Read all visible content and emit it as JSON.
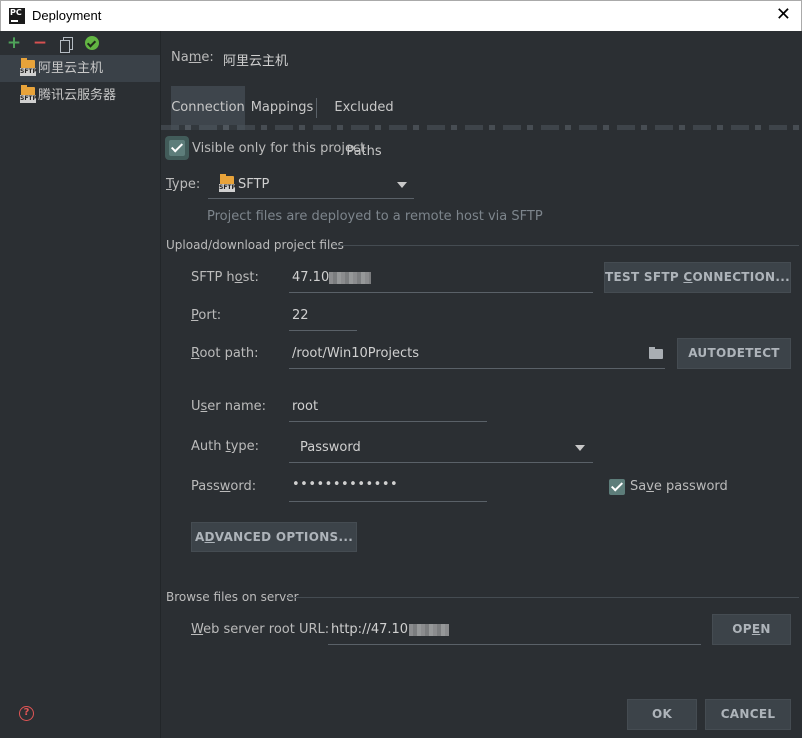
{
  "window": {
    "app_icon": "PC",
    "title": "Deployment",
    "close": "✕"
  },
  "sidebar": {
    "toolbar": {
      "add": "+",
      "remove": "−"
    },
    "servers": [
      {
        "label": "阿里云主机",
        "icon_tag": "SFTP"
      },
      {
        "label": "腾讯云服务器",
        "icon_tag": "SFTP"
      }
    ],
    "help": "?"
  },
  "name": {
    "label_pre": "Na",
    "label_mnemonic": "m",
    "label_post": "e:",
    "value": "阿里云主机"
  },
  "tabs": [
    {
      "label": "Connection",
      "active": true
    },
    {
      "label": "Mappings",
      "active": false
    },
    {
      "label": "Excluded Paths",
      "active": false
    }
  ],
  "visible_only": {
    "label": "Visible only for this project",
    "checked": true
  },
  "type": {
    "label_mnemonic": "T",
    "label_post": "ype:",
    "value": "SFTP",
    "icon_tag": "SFTP",
    "hint": "Project files are deployed to a remote host via SFTP"
  },
  "upload_section": {
    "title": "Upload/download project files",
    "sftp_host": {
      "label_pre": "SFTP h",
      "label_mnemonic": "o",
      "label_post": "st:",
      "value": "47.10"
    },
    "test_button": {
      "pre": "TEST SFTP ",
      "mnemonic": "C",
      "post": "ONNECTION..."
    },
    "port": {
      "label_mnemonic": "P",
      "label_post": "ort:",
      "value": "22"
    },
    "root_path": {
      "label_mnemonic": "R",
      "label_post": "oot path:",
      "value": "/root/Win10Projects"
    },
    "autodetect_button": "AUTODETECT",
    "user_name": {
      "label_pre": "U",
      "label_mnemonic": "s",
      "label_post": "er name:",
      "value": "root"
    },
    "auth_type": {
      "label_pre": "Auth ",
      "label_mnemonic": "t",
      "label_post": "ype:",
      "value": "Password"
    },
    "password": {
      "label_pre": "Pass",
      "label_mnemonic": "w",
      "label_post": "ord:",
      "value": "•••••••••••••"
    },
    "save_password": {
      "label_pre": "Sa",
      "label_mnemonic": "v",
      "label_post": "e password",
      "checked": true
    },
    "advanced_button": {
      "pre": "A",
      "mnemonic": "D",
      "post": "VANCED OPTIONS..."
    }
  },
  "browse_section": {
    "title": "Browse files on server",
    "web_root": {
      "label_mnemonic": "W",
      "label_post": "eb server root URL:",
      "value": "http://47.10"
    },
    "open_button": {
      "pre": "OP",
      "mnemonic": "E",
      "post": "N"
    }
  },
  "footer": {
    "ok": "OK",
    "cancel": "CANCEL"
  },
  "colors": {
    "background": "#2b2f33",
    "selected": "#3a4148",
    "checkbox": "#5d7d7a",
    "add": "#4fa35a",
    "remove": "#d75151",
    "help": "#e05555"
  }
}
